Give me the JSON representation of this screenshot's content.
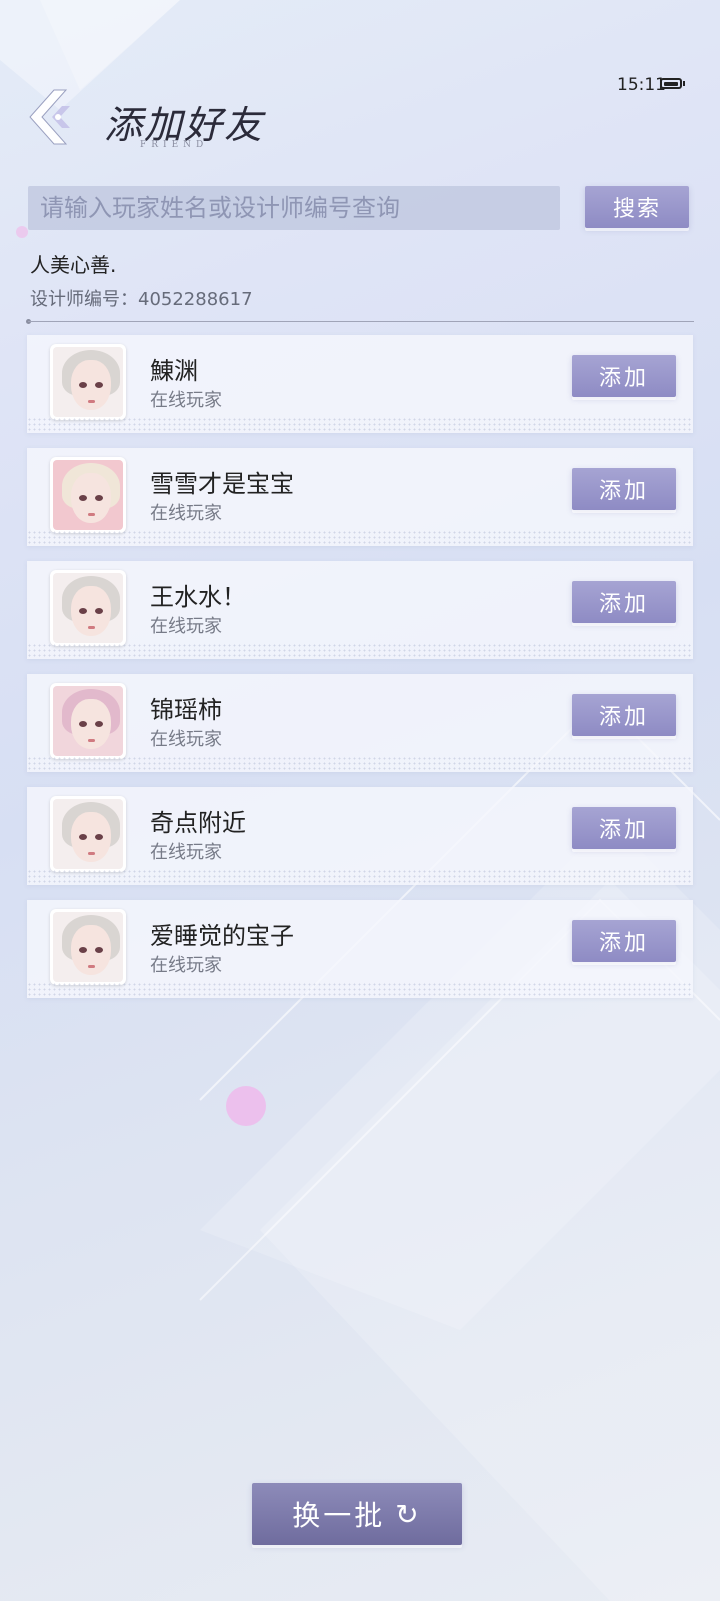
{
  "status_bar": {
    "time": "15:11"
  },
  "header": {
    "title": "添加好友",
    "subtitle": "FRIEND"
  },
  "search": {
    "placeholder": "请输入玩家姓名或设计师编号查询",
    "value": "",
    "button_label": "搜索"
  },
  "me": {
    "name": "人美心善.",
    "designer_id_text": "设计师编号：4052288617"
  },
  "players": [
    {
      "name": "鯟渊",
      "status": "在线玩家",
      "add_label": "添加",
      "avatar": "white-hair-portrait"
    },
    {
      "name": "雪雪才是宝宝",
      "status": "在线玩家",
      "add_label": "添加",
      "avatar": "pink-costume-portrait"
    },
    {
      "name": "王水水！",
      "status": "在线玩家",
      "add_label": "添加",
      "avatar": "white-hair-portrait"
    },
    {
      "name": "锦瑶柿",
      "status": "在线玩家",
      "add_label": "添加",
      "avatar": "pink-hair-portrait"
    },
    {
      "name": "奇点附近",
      "status": "在线玩家",
      "add_label": "添加",
      "avatar": "white-hair-portrait"
    },
    {
      "name": "爱睡觉的宝子",
      "status": "在线玩家",
      "add_label": "添加",
      "avatar": "white-hair-portrait"
    }
  ],
  "footer": {
    "refresh_label": "换一批",
    "refresh_icon": "refresh-icon"
  },
  "colors": {
    "button": "#9a98cc",
    "refresh_button": "#7f7cad",
    "card": "#f5f7fd"
  }
}
